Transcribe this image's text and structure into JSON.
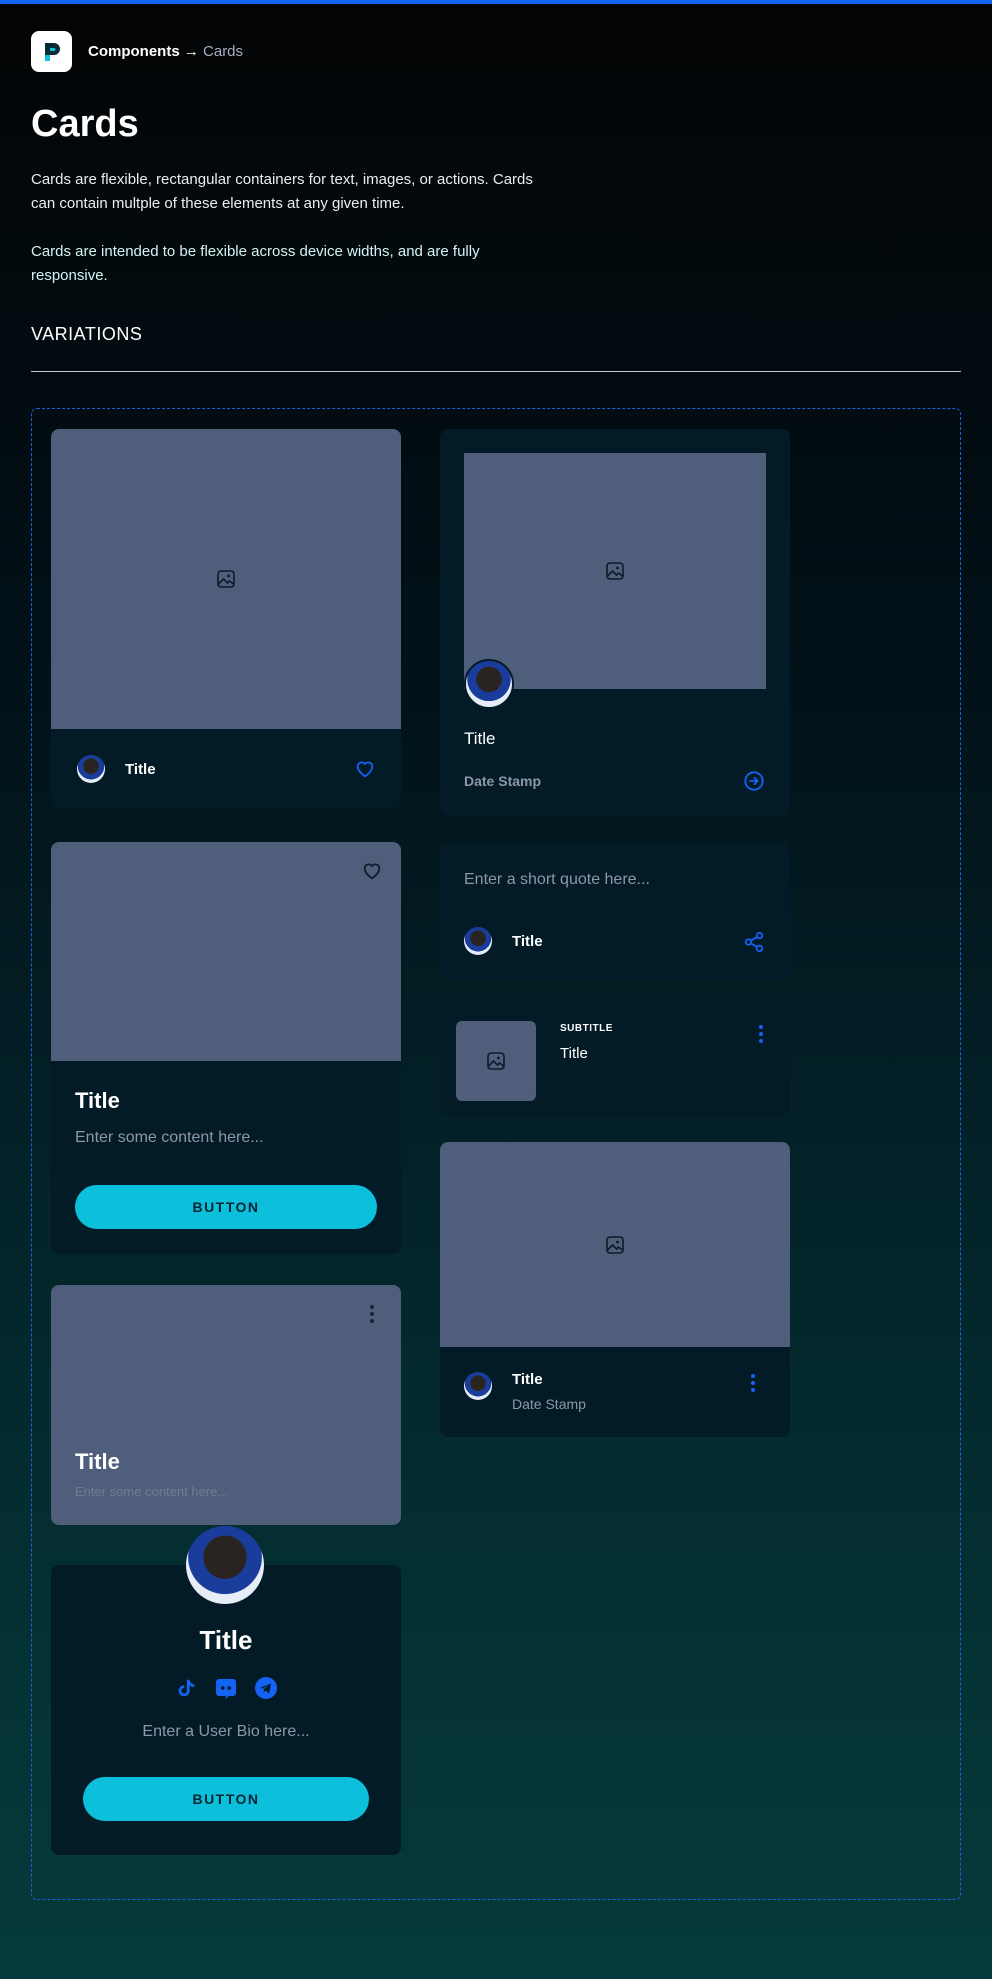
{
  "breadcrumb": {
    "parent": "Components",
    "separator": "→",
    "current": "Cards"
  },
  "page": {
    "title": "Cards",
    "description_1": "Cards are flexible, rectangular containers for text, images, or actions. Cards can contain multple of these elements at any given time.",
    "description_2": "Cards are intended to be flexible across device widths, and are fully responsive.",
    "section_title": "VARIATIONS"
  },
  "cards": {
    "image_footer": {
      "title": "Title"
    },
    "avatar_overlap": {
      "title": "Title",
      "date": "Date Stamp"
    },
    "content_button": {
      "title": "Title",
      "content": "Enter some content here...",
      "button": "BUTTON"
    },
    "quote": {
      "placeholder": "Enter a short quote here...",
      "title": "Title"
    },
    "list_item": {
      "subtitle": "SUBTITLE",
      "title": "Title"
    },
    "media_footer": {
      "title": "Title",
      "date": "Date Stamp"
    },
    "overlay": {
      "title": "Title",
      "content": "Enter some content here..."
    },
    "profile": {
      "title": "Title",
      "bio": "Enter a User Bio here...",
      "button": "BUTTON",
      "socials": [
        "tiktok-icon",
        "discord-icon",
        "telegram-icon"
      ]
    }
  },
  "colors": {
    "accent": "#1463f3",
    "button": "#0cc0dc",
    "card": "#031a27",
    "placeholder": "#4f5e7a"
  }
}
